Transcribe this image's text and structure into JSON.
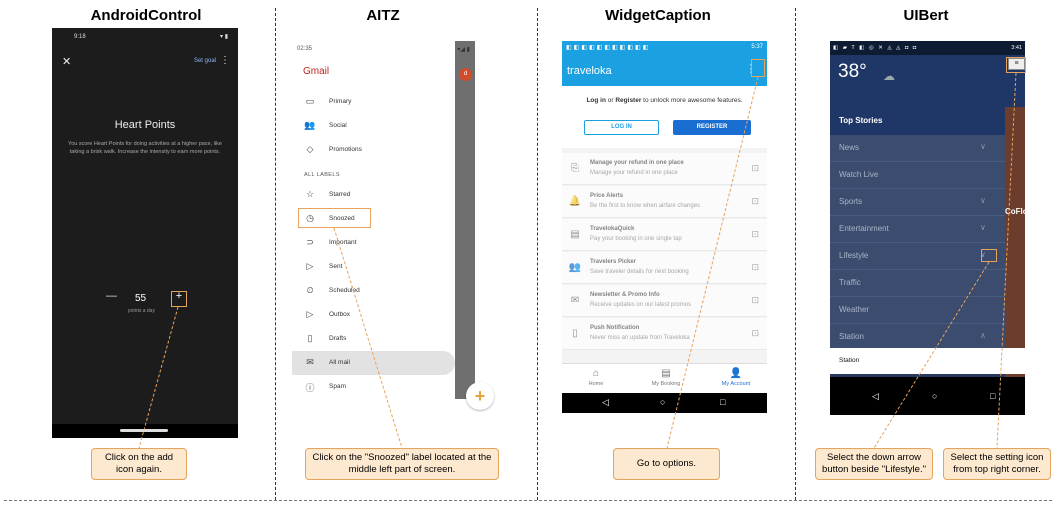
{
  "columns": [
    {
      "title": "AndroidControl"
    },
    {
      "title": "AITZ"
    },
    {
      "title": "WidgetCaption"
    },
    {
      "title": "UIBert"
    }
  ],
  "android_control": {
    "time": "9:18",
    "status_icons": "▾ ▮",
    "set_goal": "Set goal",
    "title": "Heart Points",
    "description": "You score Heart Points for doing activities at a higher pace, like taking a brisk walk. Increase the intensity to earn more points.",
    "value": "55",
    "unit": "points a day",
    "instruction": "Click on the add icon again."
  },
  "aitz": {
    "time": "02:35",
    "status_icons": "▾◢ ▮",
    "app_title": "Gmail",
    "avatar_letter": "d",
    "items": [
      {
        "label": "Primary",
        "icon": "▭"
      },
      {
        "label": "Social",
        "icon": "👥"
      },
      {
        "label": "Promotions",
        "icon": "◇"
      }
    ],
    "section_label": "ALL LABELS",
    "label_items": [
      {
        "label": "Starred",
        "icon": "☆"
      },
      {
        "label": "Snoozed",
        "icon": "◷"
      },
      {
        "label": "Important",
        "icon": "⊃"
      },
      {
        "label": "Sent",
        "icon": "▷"
      },
      {
        "label": "Scheduled",
        "icon": "⏲"
      },
      {
        "label": "Outbox",
        "icon": "▷"
      },
      {
        "label": "Drafts",
        "icon": "▯"
      },
      {
        "label": "All mail",
        "icon": "✉"
      },
      {
        "label": "Spam",
        "icon": "ⓘ"
      }
    ],
    "instruction": "Click on the \"Snoozed\" label located at the middle left part of screen."
  },
  "widget_caption": {
    "time": "5:37",
    "logo": "traveloka",
    "login_prompt_pre": "Log in",
    "login_prompt_mid": " or ",
    "login_prompt_reg": "Register",
    "login_prompt_post": " to unlock more awesome features.",
    "login_button": "LOG IN",
    "register_button": "REGISTER",
    "rows": [
      {
        "title": "Manage your refund in one place",
        "subtitle": "Manage your refund in one place",
        "icon": "⎘"
      },
      {
        "title": "Price Alerts",
        "subtitle": "Be the first to know when airfare changes",
        "icon": "🔔"
      },
      {
        "title": "TravelokaQuick",
        "subtitle": "Pay your booking in one single tap",
        "icon": "▤"
      },
      {
        "title": "Travelers Picker",
        "subtitle": "Save traveler details for next booking",
        "icon": "👥"
      },
      {
        "title": "Newsletter & Promo Info",
        "subtitle": "Receive updates on our latest promos",
        "icon": "✉"
      },
      {
        "title": "Push Notification",
        "subtitle": "Never miss an update from Traveloka",
        "icon": "▯"
      }
    ],
    "tabs": [
      {
        "label": "Home",
        "icon": "⌂"
      },
      {
        "label": "My Booking",
        "icon": "▤"
      },
      {
        "label": "My Account",
        "icon": "👤"
      }
    ],
    "instruction": "Go to options."
  },
  "uibert": {
    "time": "3:41",
    "temperature": "38°",
    "section": "Top Stories",
    "nav": [
      {
        "label": "News",
        "chevron": "∨"
      },
      {
        "label": "Watch Live",
        "chevron": ""
      },
      {
        "label": "Sports",
        "chevron": "∨"
      },
      {
        "label": "Entertainment",
        "chevron": "∨"
      },
      {
        "label": "Lifestyle",
        "chevron": "∨"
      },
      {
        "label": "Traffic",
        "chevron": ""
      },
      {
        "label": "Weather",
        "chevron": ""
      },
      {
        "label": "Station",
        "chevron": "∧"
      }
    ],
    "sub_item": "Station",
    "side_text": "CoFlo",
    "instruction_left": "Select the down arrow button beside \"Lifestyle.\"",
    "instruction_right": "Select the setting icon from top right corner."
  },
  "colors": {
    "callout_fill": "#fde9cf",
    "callout_border": "#e6a35c",
    "traveloka_blue": "#1ba0e2",
    "gmail_red": "#c5221f"
  }
}
